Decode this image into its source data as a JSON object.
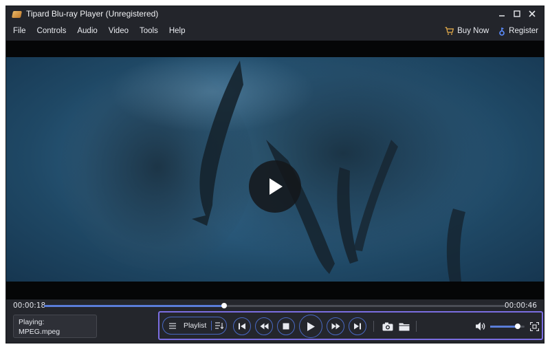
{
  "window": {
    "title": "Tipard Blu-ray Player (Unregistered)",
    "minimize_icon": "minimize-icon",
    "maximize_icon": "maximize-icon",
    "close_icon": "close-icon"
  },
  "menu": {
    "items": [
      "File",
      "Controls",
      "Audio",
      "Video",
      "Tools",
      "Help"
    ],
    "buy_now": "Buy Now",
    "register": "Register"
  },
  "player": {
    "elapsed": "00:00:18",
    "total": "00:00:46",
    "progress_fraction": 0.39,
    "volume_fraction": 0.8
  },
  "now_playing": {
    "label": "Playing:",
    "file": "MPEG.mpeg"
  },
  "controls": {
    "playlist_label": "Playlist",
    "buttons": [
      "skip-previous",
      "rewind",
      "stop",
      "play",
      "fast-forward",
      "skip-next"
    ],
    "tools": [
      "snapshot",
      "open-folder",
      "volume",
      "fullscreen"
    ]
  },
  "colors": {
    "accent": "#4969c4",
    "highlight_border": "#7b6ee2",
    "background": "#24262c"
  }
}
